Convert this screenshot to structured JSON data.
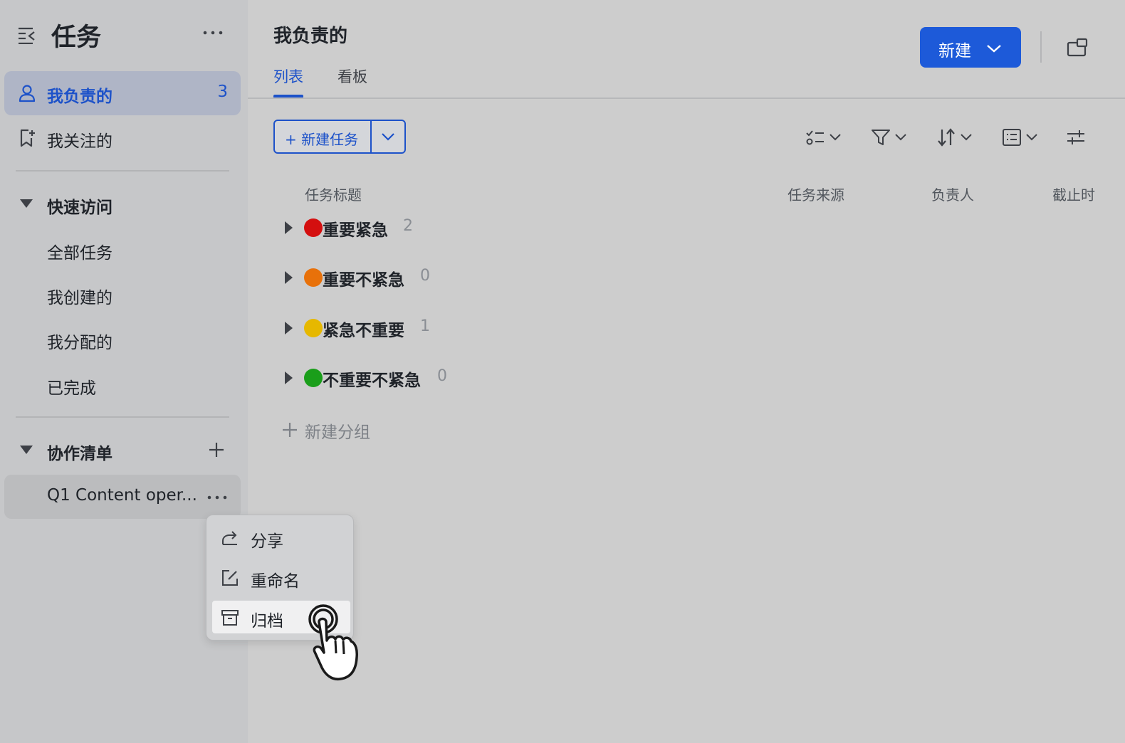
{
  "sidebar": {
    "title": "任务",
    "nav": [
      {
        "label": "我负责的",
        "count": "3"
      },
      {
        "label": "我关注的"
      }
    ],
    "quick_access": {
      "label": "快速访问",
      "items": [
        "全部任务",
        "我创建的",
        "我分配的",
        "已完成"
      ]
    },
    "collab": {
      "label": "协作清单",
      "items": [
        {
          "label": "Q1 Content oper..."
        }
      ]
    }
  },
  "header": {
    "title": "我负责的",
    "tabs": [
      "列表",
      "看板"
    ],
    "new_button": "新建"
  },
  "toolbar": {
    "new_task": "+ 新建任务"
  },
  "table": {
    "columns": [
      "任务标题",
      "任务来源",
      "负责人",
      "截止时"
    ]
  },
  "groups": [
    {
      "label": "重要紧急",
      "count": "2",
      "color": "#d40f0f"
    },
    {
      "label": "重要不紧急",
      "count": "0",
      "color": "#e8710a"
    },
    {
      "label": "紧急不重要",
      "count": "1",
      "color": "#e6b800"
    },
    {
      "label": "不重要不紧急",
      "count": "0",
      "color": "#1a9e1a"
    }
  ],
  "add_group": "新建分组",
  "context_menu": {
    "items": [
      "分享",
      "重命名",
      "归档"
    ]
  },
  "colors": {
    "accent": "#1d52c9",
    "sidebar_bg": "#c6c7c9",
    "main_bg": "#cdcdcd"
  }
}
